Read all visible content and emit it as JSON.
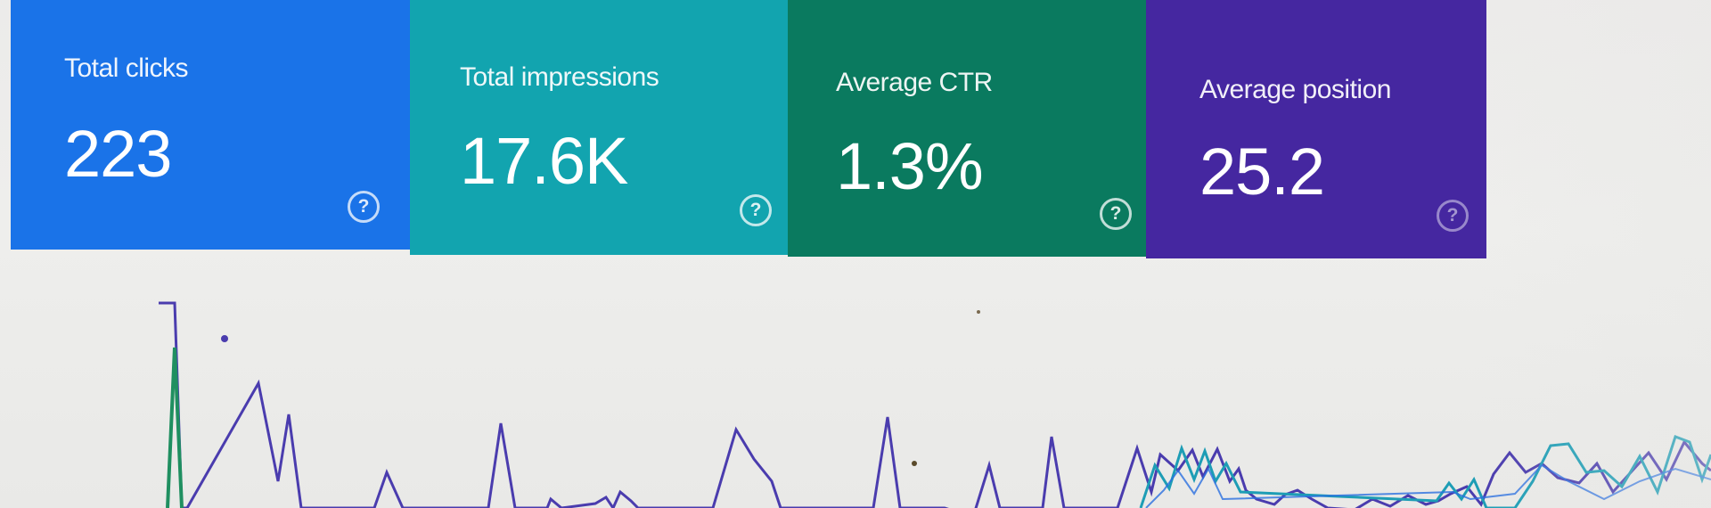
{
  "metrics": [
    {
      "label": "Total clicks",
      "value": "223",
      "color": "#1a73e8"
    },
    {
      "label": "Total impressions",
      "value": "17.6K",
      "color": "#12a4af"
    },
    {
      "label": "Average CTR",
      "value": "1.3%",
      "color": "#0a7a5f"
    },
    {
      "label": "Average position",
      "value": "25.2",
      "color": "#4527a0"
    }
  ],
  "help_icon": "help-circle-icon",
  "chart_colors": {
    "clicks": "#1a73e8",
    "impressions": "#12a4af",
    "ctr": "#0a7a5f",
    "position": "#4527a0"
  }
}
